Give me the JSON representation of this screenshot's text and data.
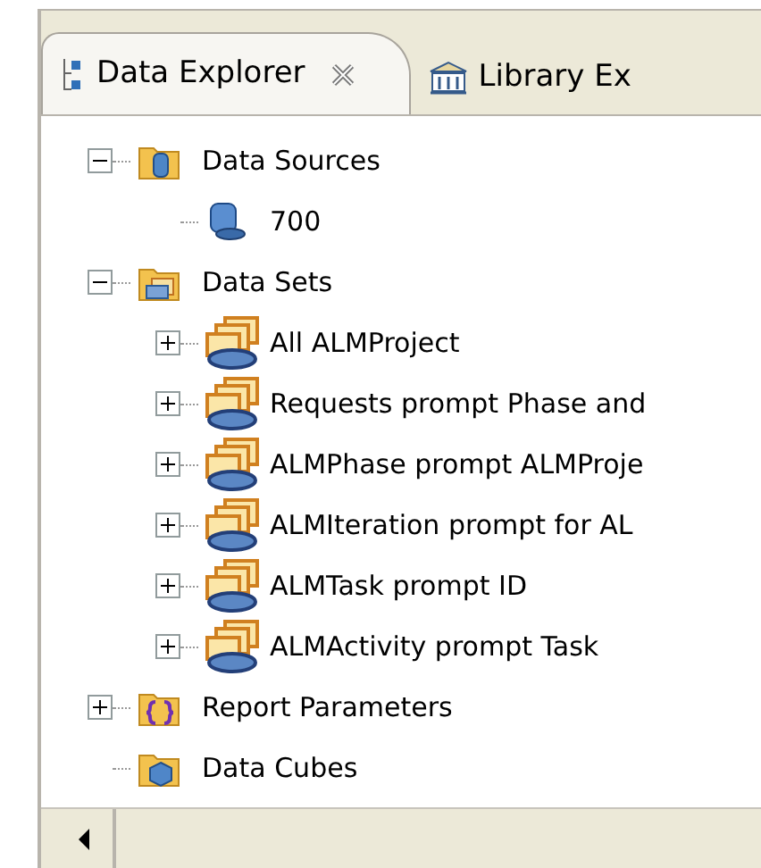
{
  "tabs": [
    {
      "label": "Data Explorer",
      "selected": true,
      "closable": true
    },
    {
      "label": "Library Ex",
      "selected": false,
      "closable": false
    }
  ],
  "tree": [
    {
      "label": "Data Sources",
      "kind": "sources",
      "expanded": true,
      "children": [
        {
          "label": "700",
          "kind": "source"
        }
      ]
    },
    {
      "label": "Data Sets",
      "kind": "sets",
      "expanded": true,
      "children": [
        {
          "label": "All ALMProject",
          "kind": "set",
          "expanded": false
        },
        {
          "label": "Requests prompt Phase and",
          "kind": "set",
          "expanded": false
        },
        {
          "label": "ALMPhase prompt ALMProje",
          "kind": "set",
          "expanded": false
        },
        {
          "label": "ALMIteration prompt for AL",
          "kind": "set",
          "expanded": false
        },
        {
          "label": "ALMTask prompt ID",
          "kind": "set",
          "expanded": false
        },
        {
          "label": "ALMActivity prompt Task",
          "kind": "set",
          "expanded": false
        }
      ]
    },
    {
      "label": "Report Parameters",
      "kind": "params",
      "expanded": false
    },
    {
      "label": "Data Cubes",
      "kind": "cubes"
    }
  ]
}
